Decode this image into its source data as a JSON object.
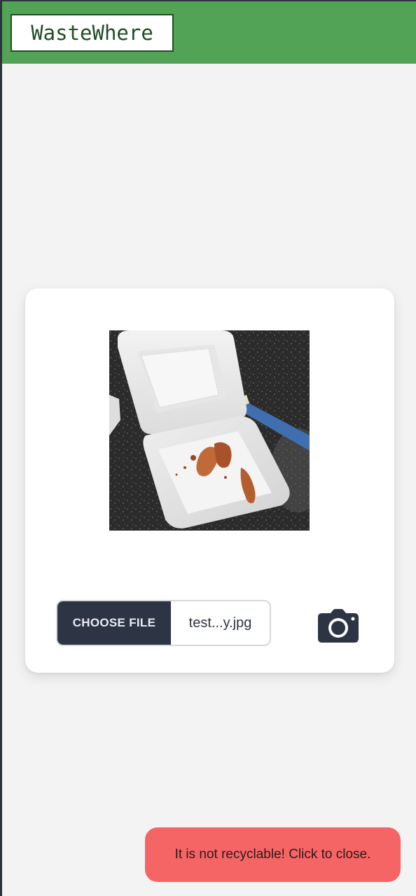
{
  "header": {
    "logo_text": "WasteWhere",
    "background_color": "#52a356"
  },
  "upload_card": {
    "preview_image": {
      "description": "styrofoam-takeout-container-photo"
    },
    "file_input": {
      "button_label": "CHOOSE FILE",
      "file_name": "test...y.jpg"
    },
    "camera_button": {
      "icon": "camera-icon"
    }
  },
  "toast": {
    "message": "It is not recyclable! Click to close.",
    "background_color": "#f56565"
  }
}
